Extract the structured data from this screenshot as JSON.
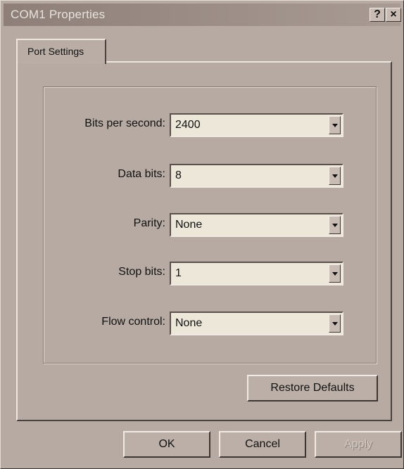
{
  "window": {
    "title": "COM1 Properties"
  },
  "titlebar": {
    "help_label": "?",
    "close_label": "×"
  },
  "tabs": [
    {
      "label": "Port Settings"
    }
  ],
  "fields": [
    {
      "label": "Bits per second:",
      "value": "2400"
    },
    {
      "label": "Data bits:",
      "value": "8"
    },
    {
      "label": "Parity:",
      "value": "None"
    },
    {
      "label": "Stop bits:",
      "value": "1"
    },
    {
      "label": "Flow control:",
      "value": "None"
    }
  ],
  "buttons": {
    "restore_defaults": "Restore Defaults",
    "ok": "OK",
    "cancel": "Cancel",
    "apply": "Apply"
  }
}
